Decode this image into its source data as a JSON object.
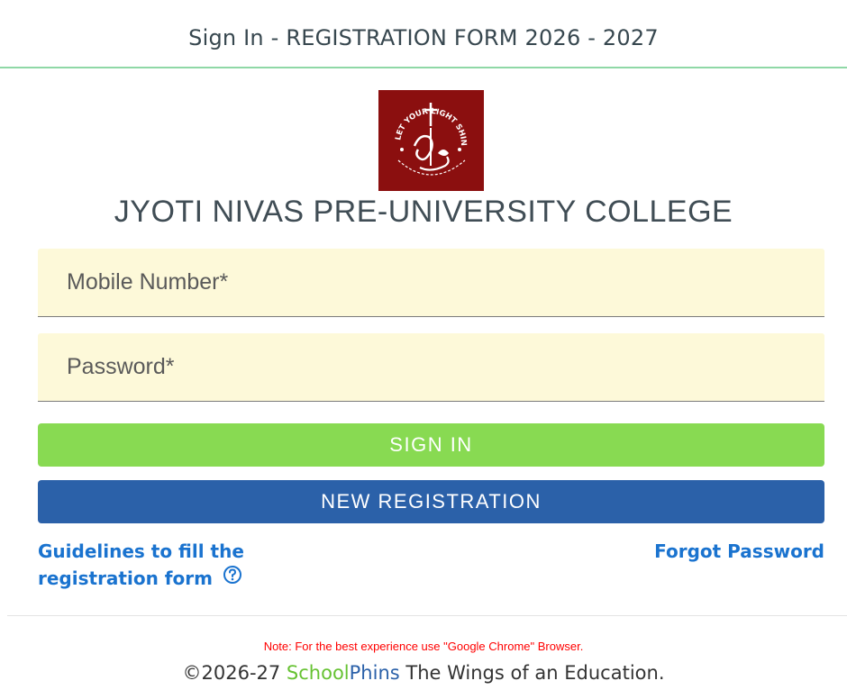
{
  "header": {
    "title": "Sign In - REGISTRATION FORM 2026 - 2027"
  },
  "logo": {
    "icon": "college-crest-logo",
    "motto": "LET YOUR LIGHT SHINE",
    "bg_color": "#8b0f0f"
  },
  "college": {
    "name": "JYOTI NIVAS PRE-UNIVERSITY COLLEGE"
  },
  "form": {
    "mobile_placeholder": "Mobile Number*",
    "mobile_value": "",
    "password_placeholder": "Password*",
    "password_value": ""
  },
  "buttons": {
    "signin_label": "SIGN IN",
    "signin_color": "#88da52",
    "register_label": "NEW REGISTRATION",
    "register_color": "#2b61a9"
  },
  "links": {
    "guidelines_line1": "Guidelines to fill the",
    "guidelines_line2": "registration form",
    "guidelines_icon": "help-circle-icon",
    "forgot_label": "Forgot Password"
  },
  "footer": {
    "note": "Note: For the best experience use \"Google Chrome\" Browser.",
    "copyright_prefix": "©2026-27 ",
    "brand_part1": "School",
    "brand_part2": "Phins",
    "copyright_suffix": " The Wings of an Education."
  }
}
